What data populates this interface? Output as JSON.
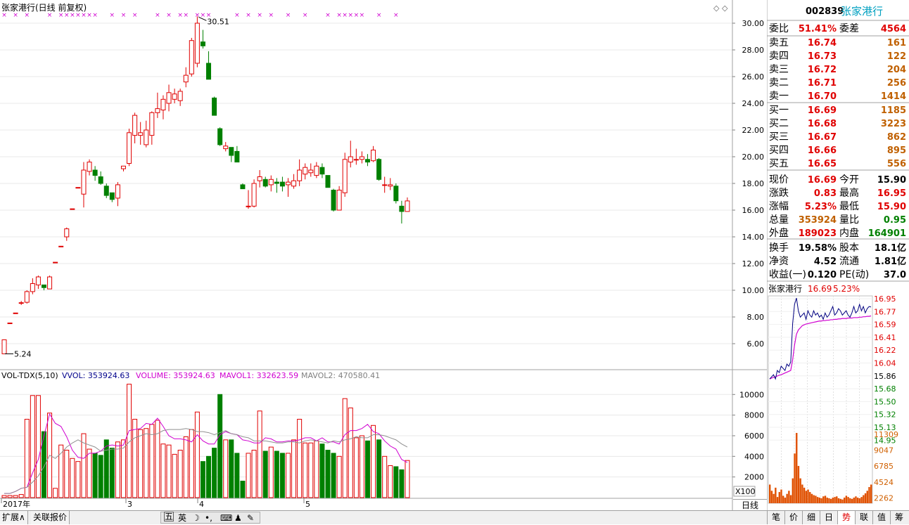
{
  "main_chart": {
    "title": "张家港行(日线 前复权)",
    "high_label": "30.51",
    "low_label": "5.24",
    "period_label": "日线",
    "scale_label": "X100",
    "price_ticks": [
      "30.00",
      "28.00",
      "26.00",
      "24.00",
      "22.00",
      "20.00",
      "18.00",
      "16.00",
      "14.00",
      "12.00",
      "10.00",
      "8.00",
      "6.00"
    ],
    "volume_ticks": [
      "10000",
      "8000",
      "6000",
      "4000",
      "2000"
    ],
    "date_labels": [
      "2017年",
      "3",
      "4",
      "5"
    ],
    "indicator": {
      "name": "VOL-TDX(5,10)",
      "vvol": "VVOL: 353924.63",
      "volume": "VOLUME: 353924.63",
      "mavol1": "MAVOL1: 332623.59",
      "mavol2": "MAVOL2: 470580.41"
    },
    "colors": {
      "up": "#e00000",
      "down": "#008000",
      "ma1": "#d000d0",
      "ma2": "#808080",
      "marker": "#d000d0"
    }
  },
  "chart_data": {
    "type": "candlestick",
    "xlabel": "",
    "ylabel": "",
    "price_range": [
      4.2,
      31.0
    ],
    "volume_range": [
      0,
      11000
    ],
    "candles": [
      {
        "o": 5.24,
        "h": 6.29,
        "l": 5.24,
        "c": 6.29,
        "v": 200
      },
      {
        "o": 7.55,
        "h": 7.55,
        "l": 7.55,
        "c": 7.55,
        "v": 200
      },
      {
        "o": 8.3,
        "h": 8.3,
        "l": 8.3,
        "c": 8.3,
        "v": 200
      },
      {
        "o": 9.07,
        "h": 9.2,
        "l": 8.9,
        "c": 9.07,
        "v": 300
      },
      {
        "o": 9.1,
        "h": 10.0,
        "l": 9.0,
        "c": 9.9,
        "v": 7600
      },
      {
        "o": 9.9,
        "h": 10.9,
        "l": 9.7,
        "c": 10.5,
        "v": 9900
      },
      {
        "o": 10.4,
        "h": 11.1,
        "l": 10.1,
        "c": 11.0,
        "v": 9900
      },
      {
        "o": 10.4,
        "h": 10.4,
        "l": 10.0,
        "c": 10.2,
        "v": 6400
      },
      {
        "o": 10.1,
        "h": 11.1,
        "l": 10.1,
        "c": 11.0,
        "v": 8200
      },
      {
        "o": 12.1,
        "h": 12.1,
        "l": 12.1,
        "c": 12.1,
        "v": 900
      },
      {
        "o": 13.3,
        "h": 13.3,
        "l": 13.3,
        "c": 13.3,
        "v": 5100
      },
      {
        "o": 14.0,
        "h": 14.7,
        "l": 13.7,
        "c": 14.6,
        "v": 4600
      },
      {
        "o": 16.1,
        "h": 16.1,
        "l": 16.1,
        "c": 16.1,
        "v": 3800
      },
      {
        "o": 17.7,
        "h": 17.7,
        "l": 17.7,
        "c": 17.7,
        "v": 3500
      },
      {
        "o": 17.2,
        "h": 19.6,
        "l": 16.2,
        "c": 19.0,
        "v": 6200
      },
      {
        "o": 18.9,
        "h": 19.8,
        "l": 18.6,
        "c": 19.6,
        "v": 4700
      },
      {
        "o": 19.0,
        "h": 19.3,
        "l": 18.2,
        "c": 18.6,
        "v": 4300
      },
      {
        "o": 18.5,
        "h": 18.9,
        "l": 17.9,
        "c": 18.0,
        "v": 4100
      },
      {
        "o": 17.8,
        "h": 18.0,
        "l": 16.9,
        "c": 17.1,
        "v": 5600
      },
      {
        "o": 17.3,
        "h": 17.3,
        "l": 16.6,
        "c": 16.8,
        "v": 4800
      },
      {
        "o": 16.9,
        "h": 18.1,
        "l": 16.3,
        "c": 17.9,
        "v": 5400
      },
      {
        "o": 19.1,
        "h": 19.3,
        "l": 18.9,
        "c": 19.3,
        "v": 5600
      },
      {
        "o": 19.5,
        "h": 22.1,
        "l": 19.3,
        "c": 21.8,
        "v": 11000
      },
      {
        "o": 21.6,
        "h": 23.3,
        "l": 21.0,
        "c": 23.1,
        "v": 7600
      },
      {
        "o": 21.6,
        "h": 22.6,
        "l": 20.9,
        "c": 21.8,
        "v": 6600
      },
      {
        "o": 20.9,
        "h": 22.7,
        "l": 20.7,
        "c": 22.0,
        "v": 6700
      },
      {
        "o": 21.6,
        "h": 23.4,
        "l": 20.9,
        "c": 23.3,
        "v": 7100
      },
      {
        "o": 23.3,
        "h": 24.8,
        "l": 22.9,
        "c": 23.6,
        "v": 7500
      },
      {
        "o": 23.5,
        "h": 24.6,
        "l": 22.8,
        "c": 24.3,
        "v": 5200
      },
      {
        "o": 24.0,
        "h": 25.4,
        "l": 23.4,
        "c": 24.8,
        "v": 5100
      },
      {
        "o": 24.3,
        "h": 25.1,
        "l": 24.0,
        "c": 24.7,
        "v": 4200
      },
      {
        "o": 24.2,
        "h": 25.1,
        "l": 23.8,
        "c": 24.9,
        "v": 4600
      },
      {
        "o": 25.6,
        "h": 26.7,
        "l": 25.2,
        "c": 26.1,
        "v": 5900
      },
      {
        "o": 26.2,
        "h": 28.9,
        "l": 26.0,
        "c": 28.7,
        "v": 6600
      },
      {
        "o": 27.0,
        "h": 30.51,
        "l": 26.7,
        "c": 30.0,
        "v": 8300
      },
      {
        "o": 28.6,
        "h": 29.5,
        "l": 28.1,
        "c": 28.3,
        "v": 3500
      },
      {
        "o": 27.0,
        "h": 27.9,
        "l": 25.8,
        "c": 25.8,
        "v": 4000
      },
      {
        "o": 24.4,
        "h": 24.5,
        "l": 23.1,
        "c": 23.1,
        "v": 4800
      },
      {
        "o": 22.1,
        "h": 22.2,
        "l": 20.8,
        "c": 20.9,
        "v": 10000
      },
      {
        "o": 20.6,
        "h": 21.1,
        "l": 20.4,
        "c": 20.8,
        "v": 5600
      },
      {
        "o": 20.7,
        "h": 20.7,
        "l": 19.6,
        "c": 20.1,
        "v": 5600
      },
      {
        "o": 20.4,
        "h": 20.8,
        "l": 19.6,
        "c": 19.6,
        "v": 4300
      },
      {
        "o": 17.9,
        "h": 18.0,
        "l": 17.6,
        "c": 17.6,
        "v": 1600
      },
      {
        "o": 16.3,
        "h": 17.5,
        "l": 16.1,
        "c": 16.3,
        "v": 4300
      },
      {
        "o": 16.3,
        "h": 18.3,
        "l": 16.2,
        "c": 18.0,
        "v": 4600
      },
      {
        "o": 18.2,
        "h": 19.0,
        "l": 17.7,
        "c": 18.5,
        "v": 8400
      },
      {
        "o": 18.3,
        "h": 18.5,
        "l": 17.7,
        "c": 17.8,
        "v": 4500
      },
      {
        "o": 17.9,
        "h": 18.6,
        "l": 17.4,
        "c": 18.3,
        "v": 4900
      },
      {
        "o": 18.1,
        "h": 18.4,
        "l": 17.3,
        "c": 18.0,
        "v": 4500
      },
      {
        "o": 18.1,
        "h": 18.5,
        "l": 17.4,
        "c": 17.8,
        "v": 4300
      },
      {
        "o": 17.9,
        "h": 18.4,
        "l": 17.0,
        "c": 18.1,
        "v": 4300
      },
      {
        "o": 17.8,
        "h": 18.7,
        "l": 17.6,
        "c": 18.2,
        "v": 5600
      },
      {
        "o": 18.2,
        "h": 19.8,
        "l": 17.8,
        "c": 19.0,
        "v": 7600
      },
      {
        "o": 18.7,
        "h": 19.5,
        "l": 18.3,
        "c": 19.2,
        "v": 5300
      },
      {
        "o": 18.8,
        "h": 19.5,
        "l": 18.5,
        "c": 19.0,
        "v": 5300
      },
      {
        "o": 18.6,
        "h": 19.6,
        "l": 18.4,
        "c": 19.3,
        "v": 5500
      },
      {
        "o": 19.2,
        "h": 19.5,
        "l": 18.4,
        "c": 18.7,
        "v": 5200
      },
      {
        "o": 18.6,
        "h": 18.6,
        "l": 17.7,
        "c": 17.7,
        "v": 4600
      },
      {
        "o": 17.5,
        "h": 17.6,
        "l": 15.9,
        "c": 16.0,
        "v": 4300
      },
      {
        "o": 16.0,
        "h": 17.8,
        "l": 16.0,
        "c": 17.5,
        "v": 4000
      },
      {
        "o": 17.3,
        "h": 20.3,
        "l": 17.0,
        "c": 19.8,
        "v": 9600
      },
      {
        "o": 19.6,
        "h": 21.2,
        "l": 19.2,
        "c": 20.0,
        "v": 8700
      },
      {
        "o": 19.8,
        "h": 20.6,
        "l": 19.4,
        "c": 19.8,
        "v": 5800
      },
      {
        "o": 19.8,
        "h": 20.4,
        "l": 19.5,
        "c": 20.0,
        "v": 6000
      },
      {
        "o": 19.8,
        "h": 20.2,
        "l": 19.3,
        "c": 19.6,
        "v": 5500
      },
      {
        "o": 19.7,
        "h": 20.8,
        "l": 19.6,
        "c": 20.5,
        "v": 7000
      },
      {
        "o": 19.8,
        "h": 19.9,
        "l": 18.2,
        "c": 18.3,
        "v": 5600
      },
      {
        "o": 17.9,
        "h": 18.5,
        "l": 17.3,
        "c": 17.9,
        "v": 4000
      },
      {
        "o": 17.8,
        "h": 18.4,
        "l": 17.5,
        "c": 17.9,
        "v": 3100
      },
      {
        "o": 17.8,
        "h": 18.0,
        "l": 16.5,
        "c": 16.7,
        "v": 3000
      },
      {
        "o": 16.3,
        "h": 16.7,
        "l": 15.0,
        "c": 15.9,
        "v": 2700
      },
      {
        "o": 15.9,
        "h": 16.95,
        "l": 15.9,
        "c": 16.69,
        "v": 3600
      }
    ],
    "ma1": [
      400,
      400,
      600,
      900,
      1000,
      2400,
      3700,
      6000,
      8100,
      7200,
      6900,
      5900,
      4600,
      3900,
      3800,
      4300,
      4300,
      4500,
      5000,
      5100,
      5000,
      5100,
      6500,
      6600,
      6700,
      7200,
      7100,
      7700,
      6900,
      6000,
      5700,
      5700,
      5600,
      5400,
      6100,
      5500,
      5200,
      5200,
      6100,
      6400,
      6200,
      6100,
      5600,
      5500,
      5300,
      5300,
      5800,
      5700,
      5400,
      5400,
      5500,
      5500,
      5600,
      5800,
      5800,
      5500,
      5800,
      5400,
      5400,
      5200,
      6100,
      6500,
      6500,
      6700,
      7100,
      6400,
      6200,
      5500,
      5000,
      4700,
      3700,
      3400
    ],
    "ma2": [
      400,
      400,
      600,
      900,
      1000,
      1500,
      2100,
      3000,
      4100,
      3800,
      4300,
      4900,
      5300,
      5600,
      5300,
      5100,
      4900,
      4500,
      4600,
      4700,
      4700,
      4800,
      5400,
      5800,
      6000,
      6200,
      6100,
      6200,
      6500,
      6600,
      6600,
      6600,
      6700,
      6600,
      6400,
      6400,
      6300,
      6100,
      6300,
      6500,
      6200,
      6100,
      5900,
      5800,
      5500,
      5500,
      5500,
      5400,
      5300,
      5300,
      5400,
      5400,
      5300,
      5500,
      5600,
      5500,
      5400,
      5300,
      5500,
      5400,
      5600,
      5700,
      5900,
      5800,
      5800,
      6100,
      6100,
      6000,
      5800,
      5600,
      5200,
      4900
    ],
    "markers_x_index": [
      0,
      2,
      4,
      8,
      10,
      11,
      12,
      13,
      14,
      15,
      16,
      19,
      21,
      23,
      27,
      29,
      31,
      32,
      34,
      35,
      36,
      41,
      43,
      45,
      47,
      50,
      53,
      57,
      59,
      60,
      61,
      62,
      63,
      66,
      69
    ]
  },
  "quote_panel": {
    "code": "002839",
    "name": "张家港行",
    "weibi_label": "委比",
    "weibi_value": "51.41%",
    "weicha_label": "委差",
    "weicha_value": "4564",
    "sells": [
      {
        "label": "卖五",
        "price": "16.74",
        "vol": "161"
      },
      {
        "label": "卖四",
        "price": "16.73",
        "vol": "122"
      },
      {
        "label": "卖三",
        "price": "16.72",
        "vol": "204"
      },
      {
        "label": "卖二",
        "price": "16.71",
        "vol": "256"
      },
      {
        "label": "卖一",
        "price": "16.70",
        "vol": "1414"
      }
    ],
    "buys": [
      {
        "label": "买一",
        "price": "16.69",
        "vol": "1185"
      },
      {
        "label": "买二",
        "price": "16.68",
        "vol": "3223"
      },
      {
        "label": "买三",
        "price": "16.67",
        "vol": "862"
      },
      {
        "label": "买四",
        "price": "16.66",
        "vol": "895"
      },
      {
        "label": "买五",
        "price": "16.65",
        "vol": "556"
      }
    ],
    "stats": [
      {
        "l1": "现价",
        "v1": "16.69",
        "c1": "#e00000",
        "l2": "今开",
        "v2": "15.90",
        "c2": "#000000"
      },
      {
        "l1": "涨跌",
        "v1": "0.83",
        "c1": "#e00000",
        "l2": "最高",
        "v2": "16.95",
        "c2": "#e00000"
      },
      {
        "l1": "涨幅",
        "v1": "5.23%",
        "c1": "#e00000",
        "l2": "最低",
        "v2": "15.90",
        "c2": "#e00000"
      },
      {
        "l1": "总量",
        "v1": "353924",
        "c1": "#c06000",
        "l2": "量比",
        "v2": "0.95",
        "c2": "#008000"
      },
      {
        "l1": "外盘",
        "v1": "189023",
        "c1": "#e00000",
        "l2": "内盘",
        "v2": "164901",
        "c2": "#008000"
      }
    ],
    "fundamentals": [
      {
        "l1": "换手",
        "v1": "19.58%",
        "l2": "股本",
        "v2": "18.1亿"
      },
      {
        "l1": "净资",
        "v1": "4.52",
        "l2": "流通",
        "v2": "1.81亿"
      },
      {
        "l1": "收益(一)",
        "v1": "0.120",
        "l2": "PE(动)",
        "v2": "37.0"
      }
    ]
  },
  "mini_chart": {
    "name": "张家港行",
    "price": "16.69",
    "pct": "5.23%",
    "price_ticks": [
      "16.95",
      "16.77",
      "16.59",
      "16.41",
      "16.22",
      "16.04",
      "15.86",
      "15.68",
      "15.50",
      "15.32",
      "15.13",
      "14.95"
    ],
    "vol_ticks": [
      "11309",
      "9047",
      "6785",
      "4524",
      "2262"
    ],
    "price_line": [
      15.0,
      15.05,
      15.1,
      15.0,
      15.2,
      15.15,
      15.3,
      15.25,
      15.2,
      15.35,
      15.3,
      15.4,
      16.3,
      16.75,
      16.9,
      16.6,
      16.45,
      16.5,
      16.55,
      16.4,
      16.6,
      16.5,
      16.45,
      16.6,
      16.5,
      16.55,
      16.45,
      16.5,
      16.4,
      16.55,
      16.45,
      16.5,
      16.6,
      16.7,
      16.5,
      16.55,
      16.65,
      16.6,
      16.5,
      16.55,
      16.6,
      16.5,
      16.45,
      16.55,
      16.7,
      16.55,
      16.6,
      16.75,
      16.6,
      16.7,
      16.55,
      16.65,
      16.7,
      16.69
    ],
    "avg_line": [
      15.0,
      15.02,
      15.04,
      15.05,
      15.07,
      15.09,
      15.1,
      15.12,
      15.14,
      15.16,
      15.18,
      15.2,
      15.45,
      15.8,
      16.05,
      16.15,
      16.2,
      16.25,
      16.27,
      16.29,
      16.3,
      16.31,
      16.32,
      16.33,
      16.34,
      16.35,
      16.36,
      16.36,
      16.37,
      16.37,
      16.38,
      16.38,
      16.39,
      16.39,
      16.4,
      16.4,
      16.41,
      16.41,
      16.42,
      16.42,
      16.42,
      16.43,
      16.43,
      16.43,
      16.44,
      16.44,
      16.44,
      16.45,
      16.45,
      16.46,
      16.46,
      16.47,
      16.47,
      16.48
    ],
    "volumes": [
      3000,
      2000,
      1500,
      2500,
      1000,
      1800,
      2200,
      1200,
      900,
      1500,
      2000,
      1300,
      4000,
      8000,
      11309,
      6000,
      4000,
      3000,
      2500,
      2000,
      2200,
      1800,
      1500,
      1300,
      1200,
      1000,
      900,
      800,
      1100,
      1200,
      900,
      800,
      700,
      900,
      1000,
      1100,
      800,
      700,
      600,
      900,
      1200,
      1000,
      800,
      700,
      900,
      1100,
      900,
      800,
      1000,
      1300,
      1600,
      2000,
      2600,
      3000
    ]
  },
  "bottom_bar": {
    "tab_expand": "扩展∧",
    "tab_related": "关联报价",
    "ime_mode": "五",
    "ime_lang": "英",
    "right_tabs": [
      "笔",
      "价",
      "细",
      "日",
      "势",
      "联",
      "值",
      "筹"
    ],
    "active_tab_index": 4
  }
}
